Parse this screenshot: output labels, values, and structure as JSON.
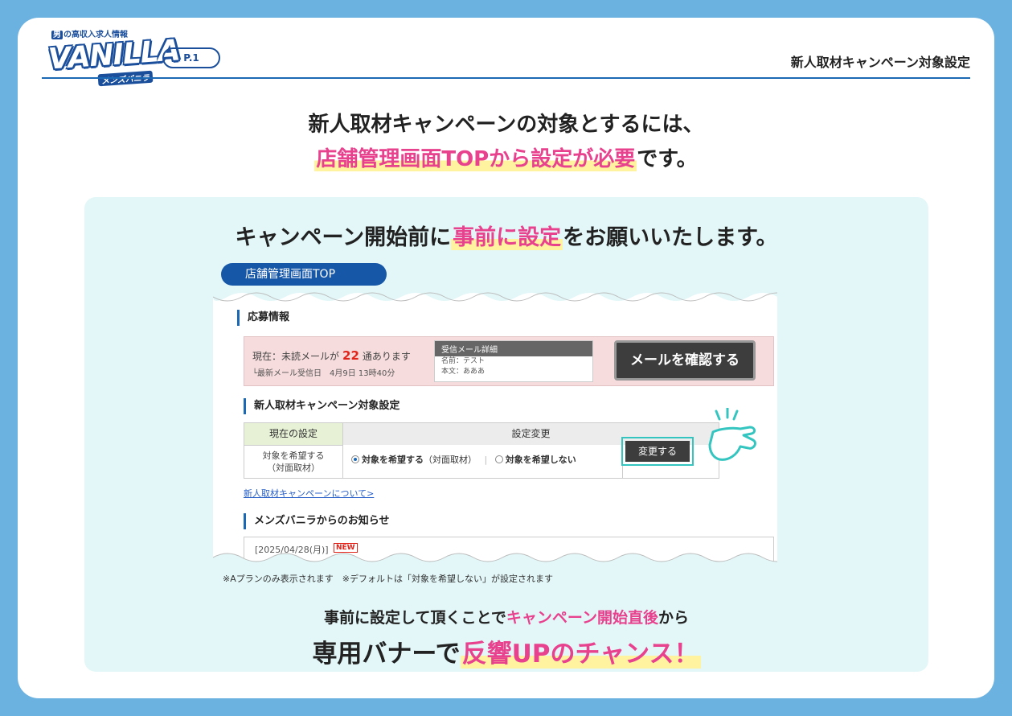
{
  "header": {
    "logo_tagline_mark": "男",
    "logo_tagline": "の高収入求人情報",
    "logo_word": "VANILLA",
    "logo_sub": "メンズバニラ",
    "page_label": "P.1",
    "title": "新人取材キャンペーン対象設定"
  },
  "headline": {
    "line1": "新人取材キャンペーンの対象とするには、",
    "line2_highlight": "店舗管理画面TOPから設定が必要",
    "line2_rest": "です。"
  },
  "panel": {
    "title_before": "キャンペーン開始前に",
    "title_highlight": "事前に設定",
    "title_after": "をお願いいたします。",
    "tag": "店舗管理画面TOP",
    "note": "※Aプランのみ表示されます　※デフォルトは「対象を希望しない」が設定されます",
    "bottom_line1_before": "事前に設定して頂くことで",
    "bottom_line1_pink": "キャンペーン開始直後",
    "bottom_line1_after": "から",
    "bottom_line2_before": "専用バナーで",
    "bottom_line2_highlight": "反響UPのチャンス！"
  },
  "screenshot": {
    "section_apply": "応募情報",
    "unread_prefix": "現在：未読メールが",
    "unread_count": "22",
    "unread_suffix": "通あります",
    "latest_mail": "└最新メール受信日　4月9日 13時40分",
    "detail_header": "受信メール詳細",
    "detail_name": "名前：テスト",
    "detail_body": "本文：あああ",
    "confirm_button": "メールを確認する",
    "section_campaign": "新人取材キャンペーン対象設定",
    "current_setting_header": "現在の設定",
    "current_setting_line1": "対象を希望する",
    "current_setting_line2": "（対面取材）",
    "change_header": "設定変更",
    "option_yes_bold": "対象を希望する",
    "option_yes_suffix": "（対面取材）",
    "option_no_bold": "対象を希望しない",
    "change_button": "変更する",
    "about_link": "新人取材キャンペーンについて>",
    "section_news": "メンズバニラからのお知らせ",
    "news_date": "[2025/04/28(月)]",
    "new_badge": "NEW"
  },
  "colors": {
    "background": "#6cb2e1",
    "brand_blue": "#1b4f9c",
    "pink": "#e8418e",
    "highlight_yellow": "#fff3a0",
    "panel": "#e3f7f8",
    "teal_accent": "#34c5c0"
  },
  "icons": {
    "pointer": "pointing-hand-icon"
  }
}
